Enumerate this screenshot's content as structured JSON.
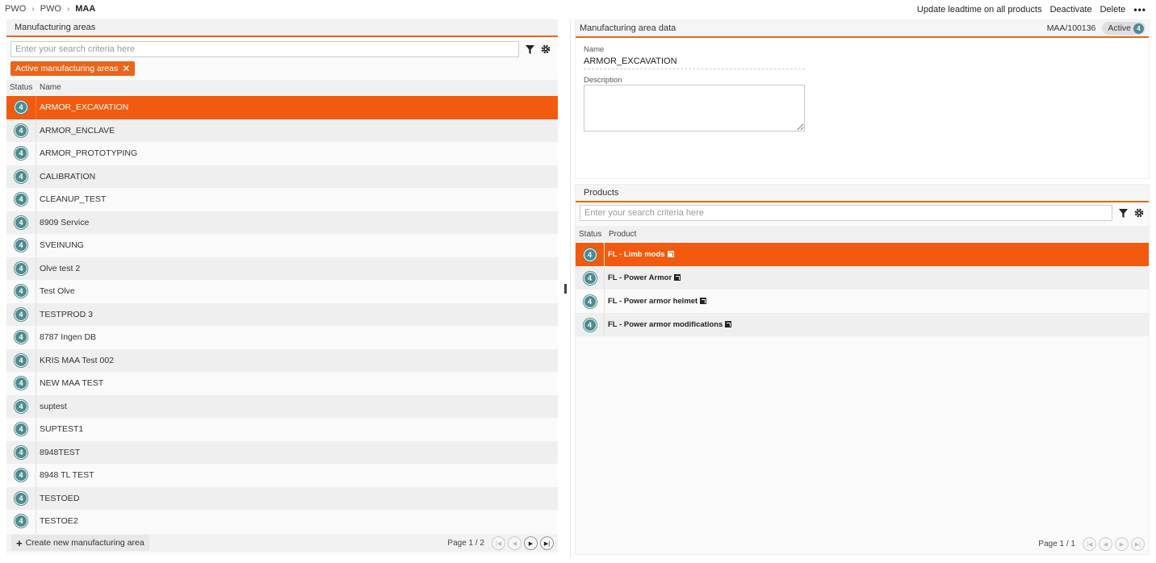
{
  "breadcrumb": {
    "items": [
      "PWO",
      "PWO"
    ],
    "current": "MAA"
  },
  "actions": {
    "update_leadtime": "Update leadtime on all products",
    "deactivate": "Deactivate",
    "delete": "Delete",
    "more": "•••"
  },
  "left_panel": {
    "title": "Manufacturing areas",
    "search_placeholder": "Enter your search criteria here",
    "filter_chip": "Active manufacturing areas",
    "columns": {
      "status": "Status",
      "name": "Name"
    },
    "status_badge": "4",
    "rows": [
      "ARMOR_EXCAVATION",
      "ARMOR_ENCLAVE",
      "ARMOR_PROTOTYPING",
      "CALIBRATION",
      "CLEANUP_TEST",
      "8909 Service",
      "SVEINUNG",
      "Olve test 2",
      "Test Olve",
      "TESTPROD 3",
      "8787 Ingen DB",
      "KRIS MAA Test 002",
      "NEW MAA TEST",
      "suptest",
      "SUPTEST1",
      "8948TEST",
      "8948 TL TEST",
      "TESTOED",
      "TESTOE2"
    ],
    "selected_index": 0,
    "create_button": "Create new manufacturing area",
    "page_text": "Page 1 / 2"
  },
  "data_panel": {
    "title": "Manufacturing area data",
    "id": "MAA/100136",
    "status_label": "Active",
    "status_badge": "4",
    "name_label": "Name",
    "name_value": "ARMOR_EXCAVATION",
    "description_label": "Description",
    "description_value": ""
  },
  "products_panel": {
    "title": "Products",
    "search_placeholder": "Enter your search criteria here",
    "columns": {
      "status": "Status",
      "product": "Product"
    },
    "status_badge": "4",
    "rows": [
      "FL - Limb mods",
      "FL - Power Armor",
      "FL - Power armor helmet",
      "FL - Power armor modifications"
    ],
    "selected_index": 0,
    "page_text": "Page 1 / 1"
  },
  "colors": {
    "accent": "#f15a0f",
    "badge": "#4e8b8f"
  }
}
